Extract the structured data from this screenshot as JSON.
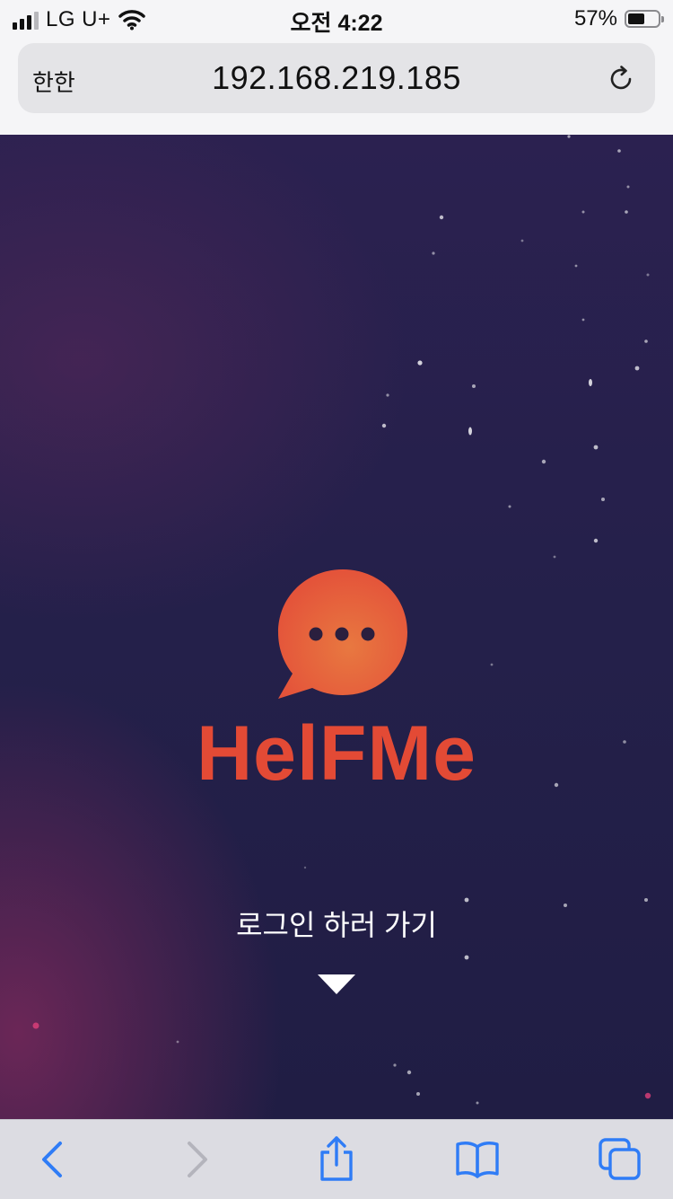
{
  "status_bar": {
    "carrier": "LG U+",
    "time": "오전 4:22",
    "battery_percent": "57%",
    "battery_level": 0.57,
    "signal_bars": 3,
    "icons": [
      "signal-icon",
      "wifi-icon",
      "battery-icon"
    ]
  },
  "address_bar": {
    "text_size_button": "한한",
    "url": "192.168.219.185",
    "reload_icon": "reload-icon"
  },
  "page": {
    "logo_text": "HelFMe",
    "login_link": "로그인 하러 가기",
    "colors": {
      "brand_red": "#e34a35",
      "bubble_orange": "#e86a3c",
      "background_navy": "#24204a"
    },
    "icons": [
      "chat-bubble-logo-icon",
      "down-arrow-icon"
    ]
  },
  "toolbar": {
    "accent": "#2f7cf6",
    "disabled": "#b4b4bc",
    "buttons": [
      {
        "name": "back",
        "icon": "chevron-left-icon",
        "enabled": true
      },
      {
        "name": "forward",
        "icon": "chevron-right-icon",
        "enabled": false
      },
      {
        "name": "share",
        "icon": "share-icon",
        "enabled": true
      },
      {
        "name": "bookmarks",
        "icon": "book-icon",
        "enabled": true
      },
      {
        "name": "tabs",
        "icon": "tabs-icon",
        "enabled": true
      }
    ]
  }
}
